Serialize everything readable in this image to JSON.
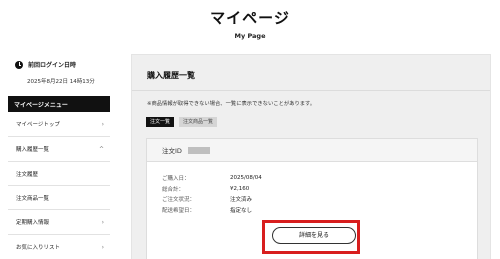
{
  "page": {
    "title": "マイページ",
    "subtitle": "My Page"
  },
  "login": {
    "label": "前回ログイン日時",
    "datetime": "2025年8月22日 14時13分"
  },
  "sidebar": {
    "header": "マイページメニュー",
    "items": [
      {
        "label": "マイページトップ",
        "icon": "chevron-right"
      },
      {
        "label": "購入履歴一覧",
        "icon": "chevron-up"
      },
      {
        "label": "注文履歴",
        "icon": ""
      },
      {
        "label": "注文商品一覧",
        "icon": ""
      },
      {
        "label": "定期購入情報",
        "icon": "chevron-right"
      },
      {
        "label": "お気に入りリスト",
        "icon": "chevron-right"
      }
    ]
  },
  "main": {
    "section_title": "購入履歴一覧",
    "notice": "※商品情報が取得できない場合、一覧に表示できないことがあります。",
    "tabs": [
      {
        "label": "注文一覧",
        "active": true
      },
      {
        "label": "注文商品一覧",
        "active": false
      }
    ],
    "order": {
      "id_label": "注文ID",
      "rows": [
        {
          "label": "ご購入日：",
          "value": "2025/08/04"
        },
        {
          "label": "総合計：",
          "value": "¥2,160"
        },
        {
          "label": "ご注文状況：",
          "value": "注文済み"
        },
        {
          "label": "配送希望日：",
          "value": "指定なし"
        }
      ],
      "detail_button": "詳細を見る"
    }
  },
  "colors": {
    "highlight": "#d81e1e",
    "menu_header_bg": "#111111"
  }
}
